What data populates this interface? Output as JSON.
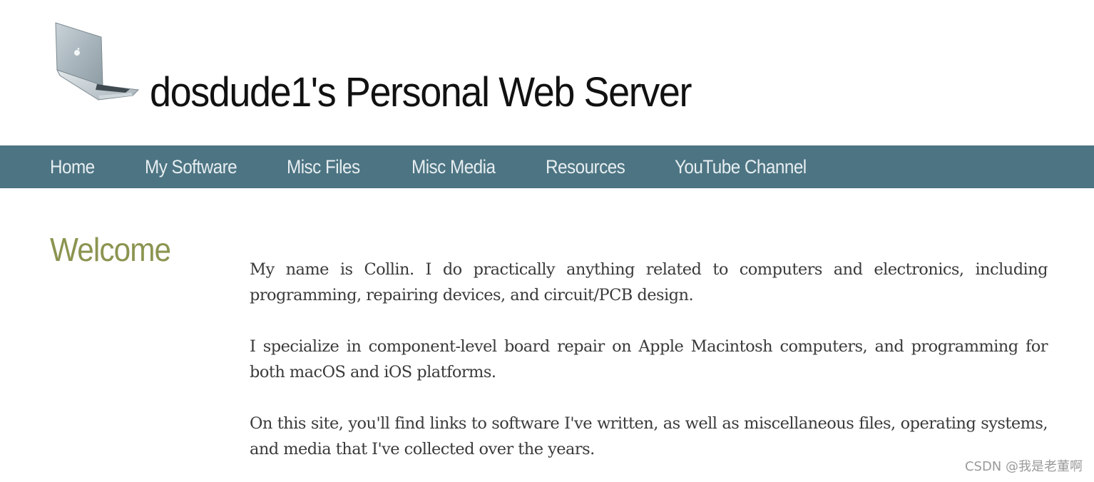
{
  "header": {
    "title": "dosdude1's Personal Web Server",
    "logo_icon": "laptop-icon"
  },
  "nav": {
    "items": [
      {
        "label": "Home"
      },
      {
        "label": "My Software"
      },
      {
        "label": "Misc Files"
      },
      {
        "label": "Misc Media"
      },
      {
        "label": "Resources"
      },
      {
        "label": "YouTube Channel"
      }
    ]
  },
  "main": {
    "heading": "Welcome",
    "paragraphs": [
      "My name is Collin. I do practically anything related to computers and electronics, including programming, repairing devices, and circuit/PCB design.",
      "I specialize in component-level board repair on Apple Macintosh computers, and programming for both macOS and iOS platforms.",
      "On this site, you'll find links to software I've written, as well as miscellaneous files, operating systems, and media that I've collected over the years."
    ]
  },
  "watermark": "CSDN @我是老董啊",
  "colors": {
    "nav_bg": "#4d7482",
    "nav_text": "#e6eef1",
    "heading": "#8c9450",
    "body_text": "#3a3a3a"
  }
}
